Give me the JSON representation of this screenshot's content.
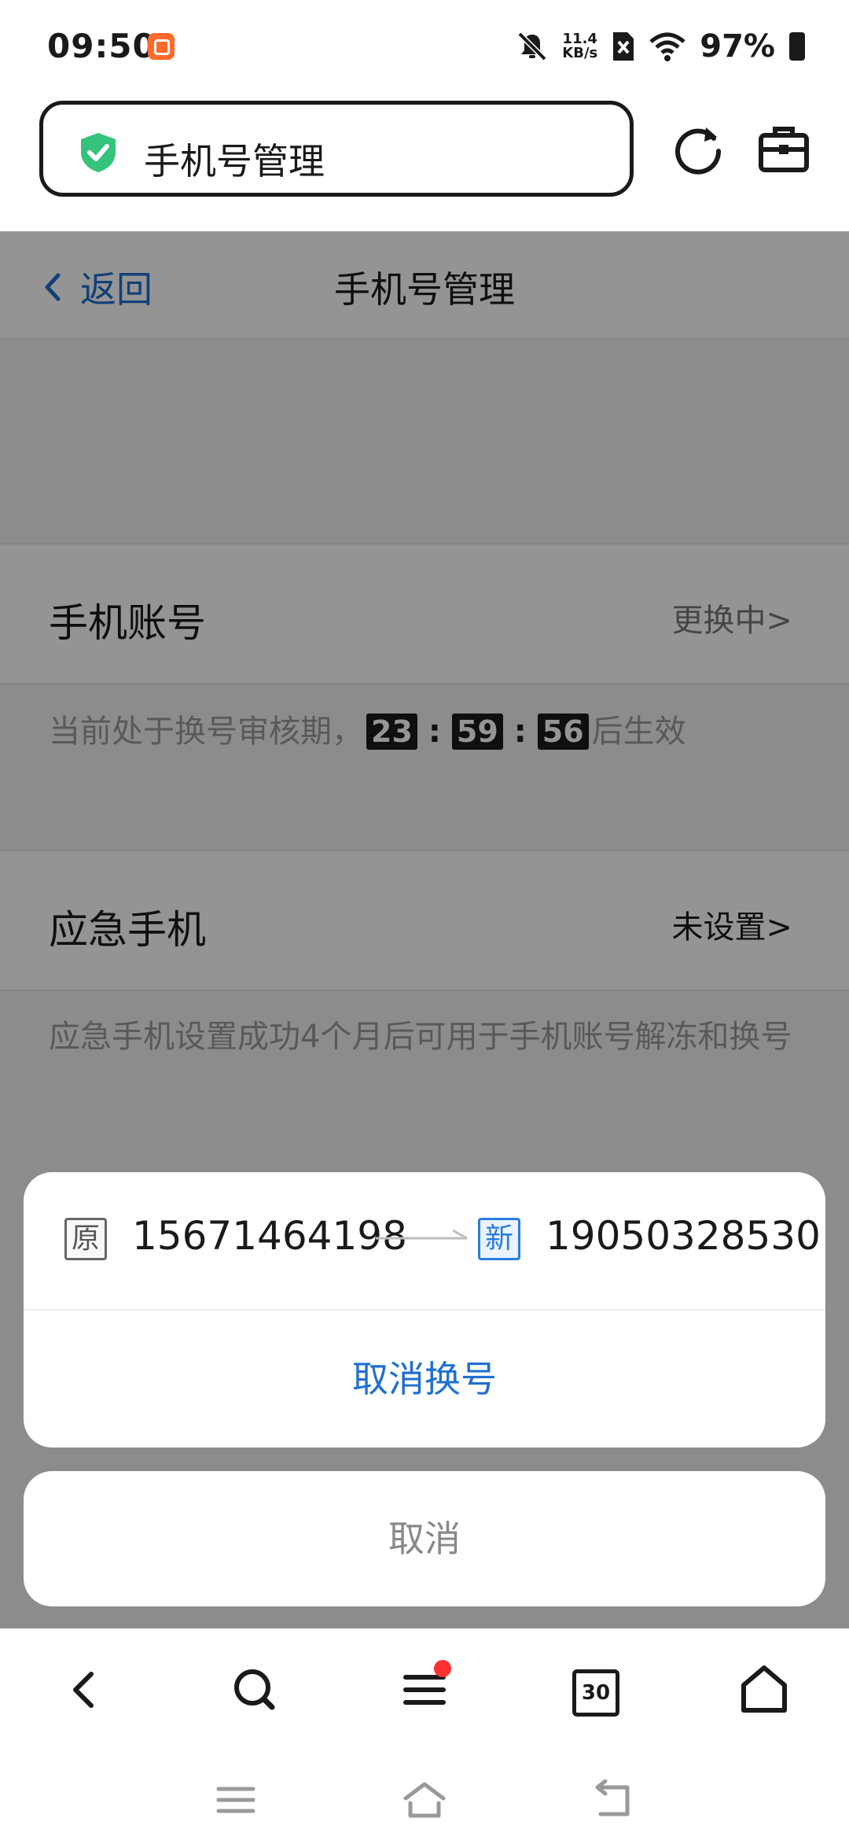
{
  "status_bar": {
    "time": "09:50",
    "net_speed_value": "11.4",
    "net_speed_unit": "KB/s",
    "battery": "97%"
  },
  "browser": {
    "address_title": "手机号管理"
  },
  "page": {
    "back_label": "返回",
    "title": "手机号管理",
    "phone_account": {
      "label": "手机账号",
      "status": "更换中>"
    },
    "review_notice": {
      "prefix": "当前处于换号审核期，",
      "hours": "23",
      "minutes": "59",
      "seconds": "56",
      "suffix": "后生效"
    },
    "emergency_phone": {
      "label": "应急手机",
      "status": "未设置>"
    },
    "emergency_notice": "应急手机设置成功4个月后可用于手机账号解冻和换号"
  },
  "sheet": {
    "old_tag": "原",
    "old_number": "15671464198",
    "new_tag": "新",
    "new_number": "19050328530",
    "cancel_change_label": "取消换号",
    "cancel_label": "取消"
  },
  "toolbar": {
    "tab_count": "30"
  },
  "colors": {
    "accent": "#1f6fcf",
    "shield": "#34c37a",
    "red_dot": "#ff3030"
  }
}
